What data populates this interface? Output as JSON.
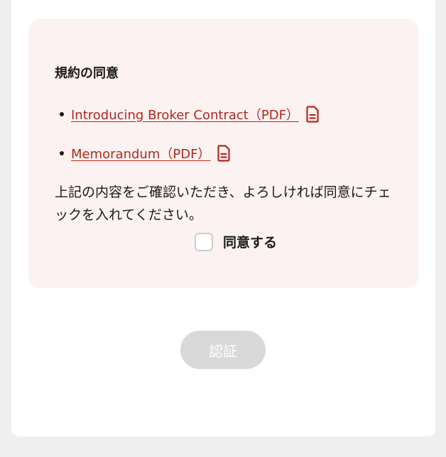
{
  "agreement": {
    "title": "規約の同意",
    "documents": [
      {
        "label": "Introducing Broker Contract（PDF）",
        "icon": "document-icon"
      },
      {
        "label": "Memorandum（PDF）",
        "icon": "document-icon"
      }
    ],
    "instruction": "上記の内容をご確認いただき、よろしければ同意にチェックを入れてください。",
    "checkbox_label": "同意する",
    "checkbox_checked": false
  },
  "actions": {
    "submit_label": "認証",
    "submit_enabled": false
  },
  "colors": {
    "link": "#b0281e",
    "panel_background": "#fcf2f1",
    "disabled_button": "#d9d9d9",
    "page_background": "#efefef"
  }
}
